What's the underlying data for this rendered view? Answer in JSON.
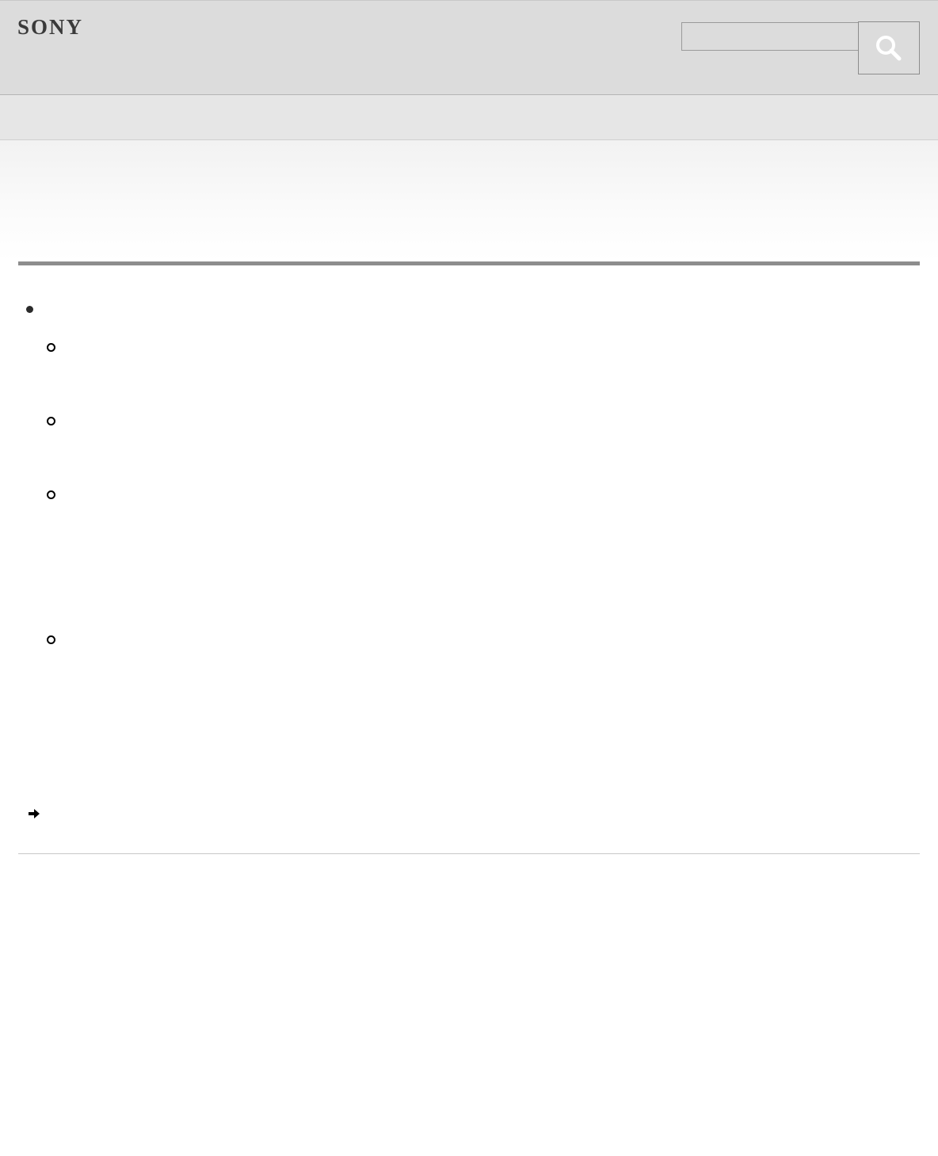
{
  "header": {
    "brand": "SONY",
    "search": {
      "value": "",
      "placeholder": ""
    }
  },
  "icons": {
    "search_button": "search-icon",
    "related_link": "arrow-right-icon"
  },
  "colors": {
    "header_bg": "#dcdcdc",
    "nav_bg": "#e6e6e6",
    "title_rule": "#8d8d8d",
    "footer_rule": "#c8c8c8"
  }
}
